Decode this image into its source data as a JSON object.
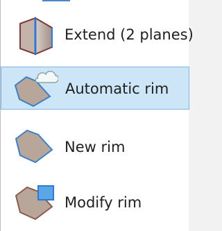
{
  "menu": {
    "items": [
      {
        "label": "Extend (2 planes)",
        "icon": "extend-planes-icon",
        "selected": false
      },
      {
        "label": "Automatic rim",
        "icon": "automatic-rim-icon",
        "selected": true
      },
      {
        "label": "New rim",
        "icon": "new-rim-icon",
        "selected": false
      },
      {
        "label": "Modify rim",
        "icon": "modify-rim-icon",
        "selected": false
      }
    ]
  },
  "colors": {
    "selection_bg": "#cde6f7",
    "selection_border": "#7eb4ea",
    "shape_fill": "#b9a69b",
    "shape_outline": "#3d7fc4",
    "accent_blue": "#2f7ad0"
  }
}
